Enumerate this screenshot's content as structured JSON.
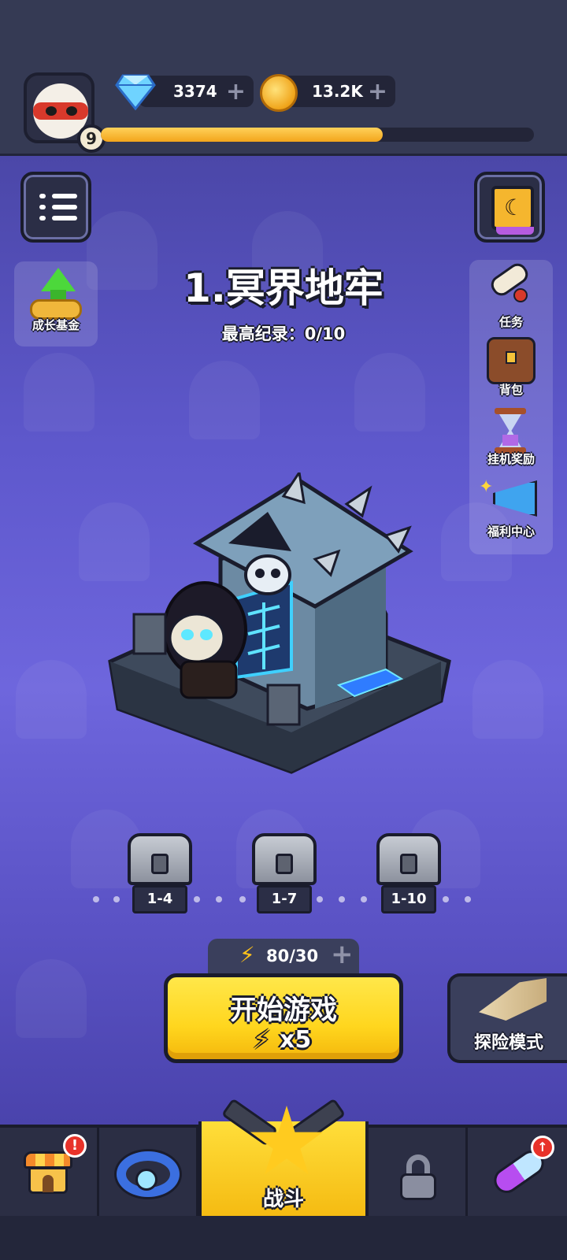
{
  "player": {
    "level": "9",
    "xp_progress_percent": 65
  },
  "currencies": {
    "gems": {
      "value": "3374",
      "plus": "+"
    },
    "gold": {
      "value": "13.2K",
      "plus": "+"
    }
  },
  "left_menu": {
    "growth_fund_label": "成长基金"
  },
  "side_menu": {
    "items": [
      {
        "label": "任务",
        "icon": "scroll-icon"
      },
      {
        "label": "背包",
        "icon": "backpack-icon"
      },
      {
        "label": "挂机奖励",
        "icon": "hourglass-icon"
      },
      {
        "label": "福利中心",
        "icon": "megaphone-icon"
      }
    ]
  },
  "stage": {
    "title": "1.冥界地牢",
    "best_record": "最高纪录：0/10"
  },
  "reward_chests": [
    {
      "label": "1-4"
    },
    {
      "label": "1-7"
    },
    {
      "label": "1-10"
    }
  ],
  "energy": {
    "value": "80/30",
    "plus": "+"
  },
  "start_button": {
    "label": "开始游戏",
    "cost": "x5"
  },
  "adventure_button": {
    "label": "探险模式"
  },
  "bottom_nav": {
    "items": [
      {
        "icon": "shop-icon",
        "badge": "!"
      },
      {
        "icon": "ring-icon"
      },
      {
        "label": "战斗",
        "icon": "star-icon",
        "active": true
      },
      {
        "icon": "lock-icon"
      },
      {
        "icon": "pill-icon",
        "badge": "↑"
      }
    ]
  },
  "colors": {
    "accent_yellow": "#ffd61e",
    "background_purple": "#5e58cc",
    "topbar": "#353a54"
  }
}
